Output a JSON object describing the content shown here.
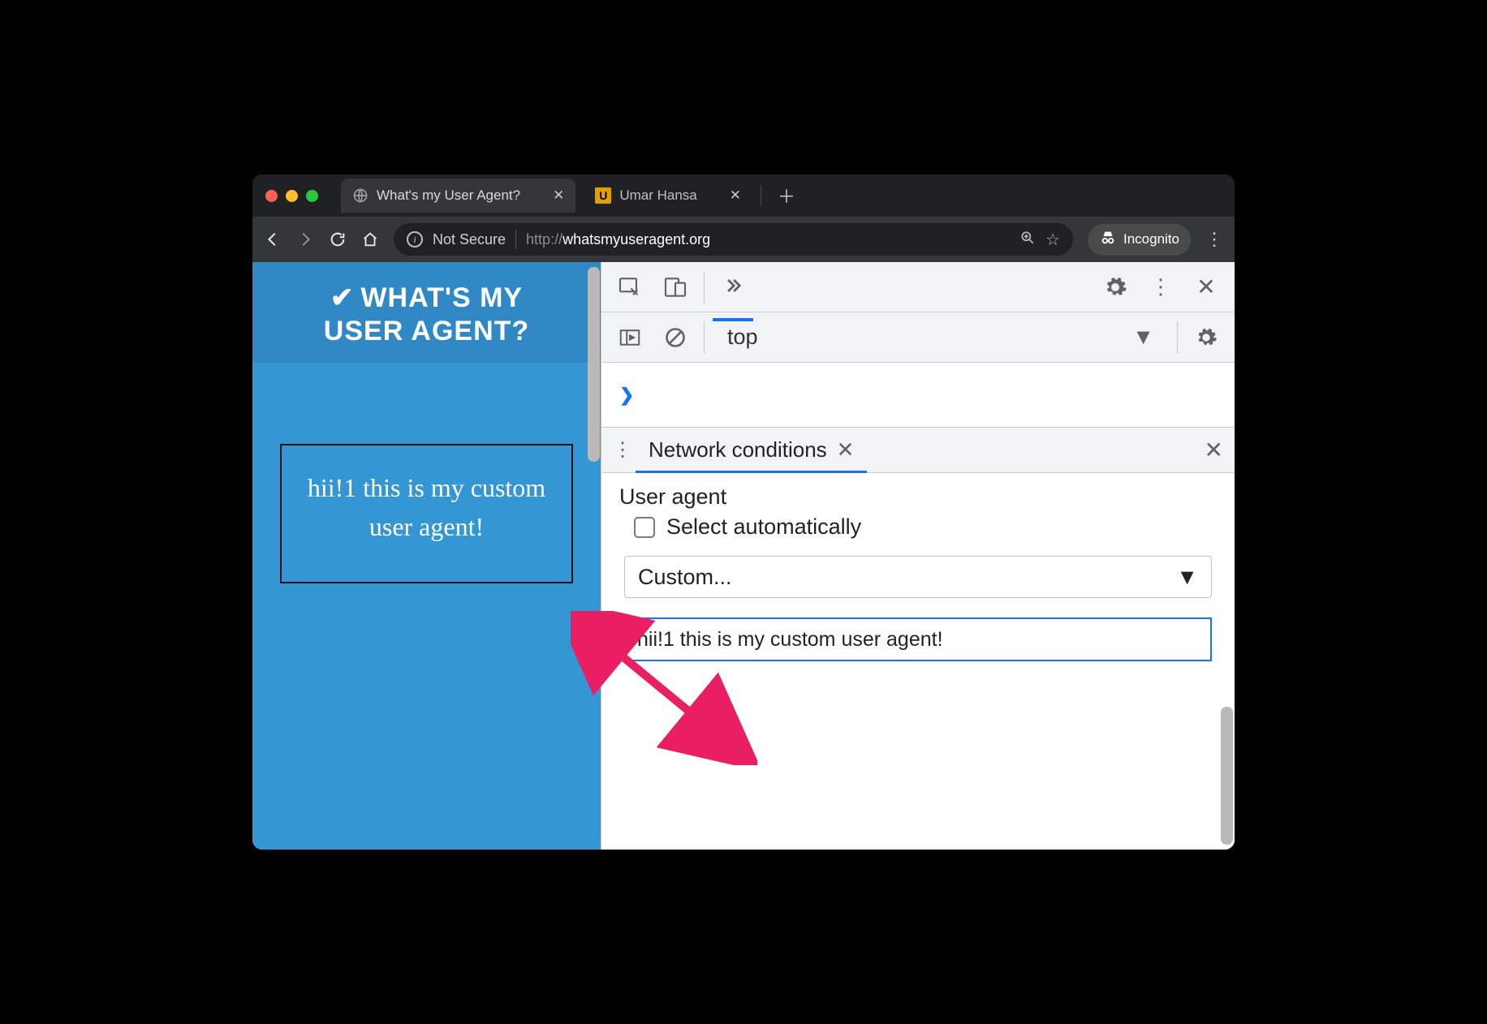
{
  "window": {
    "tabs": [
      {
        "title": "What's my User Agent?",
        "active": true
      },
      {
        "title": "Umar Hansa",
        "active": false
      }
    ]
  },
  "addressbar": {
    "security_label": "Not Secure",
    "url_prefix": "http://",
    "url_host": "whatsmyuseragent.org",
    "incognito_label": "Incognito"
  },
  "page": {
    "heading_line1": "WHAT'S MY",
    "heading_line2": "USER AGENT?",
    "detected_ua": "hii!1 this is my custom user agent!"
  },
  "devtools": {
    "context_selector": "top",
    "drawer": {
      "tab_label": "Network conditions",
      "section_label": "User agent",
      "checkbox_label": "Select automatically",
      "preset_dropdown": "Custom...",
      "ua_value": "hii!1 this is my custom user agent!"
    }
  }
}
